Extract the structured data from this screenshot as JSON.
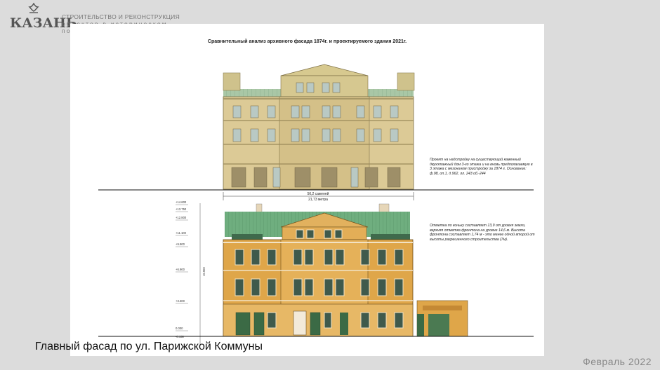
{
  "logo": {
    "text": "КАЗАНЬ"
  },
  "org": {
    "line1": "СТРОИТЕЛЬСТВО И РЕКОНСТРУКЦИЯ",
    "line2": "объектов в историческом",
    "line3": "по"
  },
  "sheet": {
    "title": "Сравнительный анализ архивного фасада 1874г. и проектируемого здания 2021г.",
    "dim_top": "50,2 саженей",
    "dim_bottom": "21,73 метра",
    "note1": "Проект на надстройку на существующий каменный двухэтажный дом 3-го этажа и на вновь предполагаемую в 3 этажа с мезонином пристройку за 1874 г. Основание: ф.98, оп.1, д.962, лл. 243 об.-244",
    "note2": "Отметка по коньку составляет 13,9 от уровня земли, верхняя отметка фронтона на уровне 14,6 м. Высота фронтона составляет 1,74 м - это менее одной второй от высоты разрешенного строительства (7м).",
    "levels": [
      "+14.600",
      "+13.750",
      "+12.800",
      "+11.100",
      "+9.900",
      "+6.900",
      "+3.300",
      "0.000",
      "-0.150"
    ],
    "height_dim": "15.900"
  },
  "caption": "Главный фасад по ул. Парижской Коммуны",
  "footer": {
    "date": "Февраль  2022"
  },
  "colors": {
    "background": "#dcdcdc",
    "sheet": "#ffffff",
    "old_facade": "#d9c894",
    "new_facade": "#dca64a",
    "roof": "#8fbf98"
  }
}
